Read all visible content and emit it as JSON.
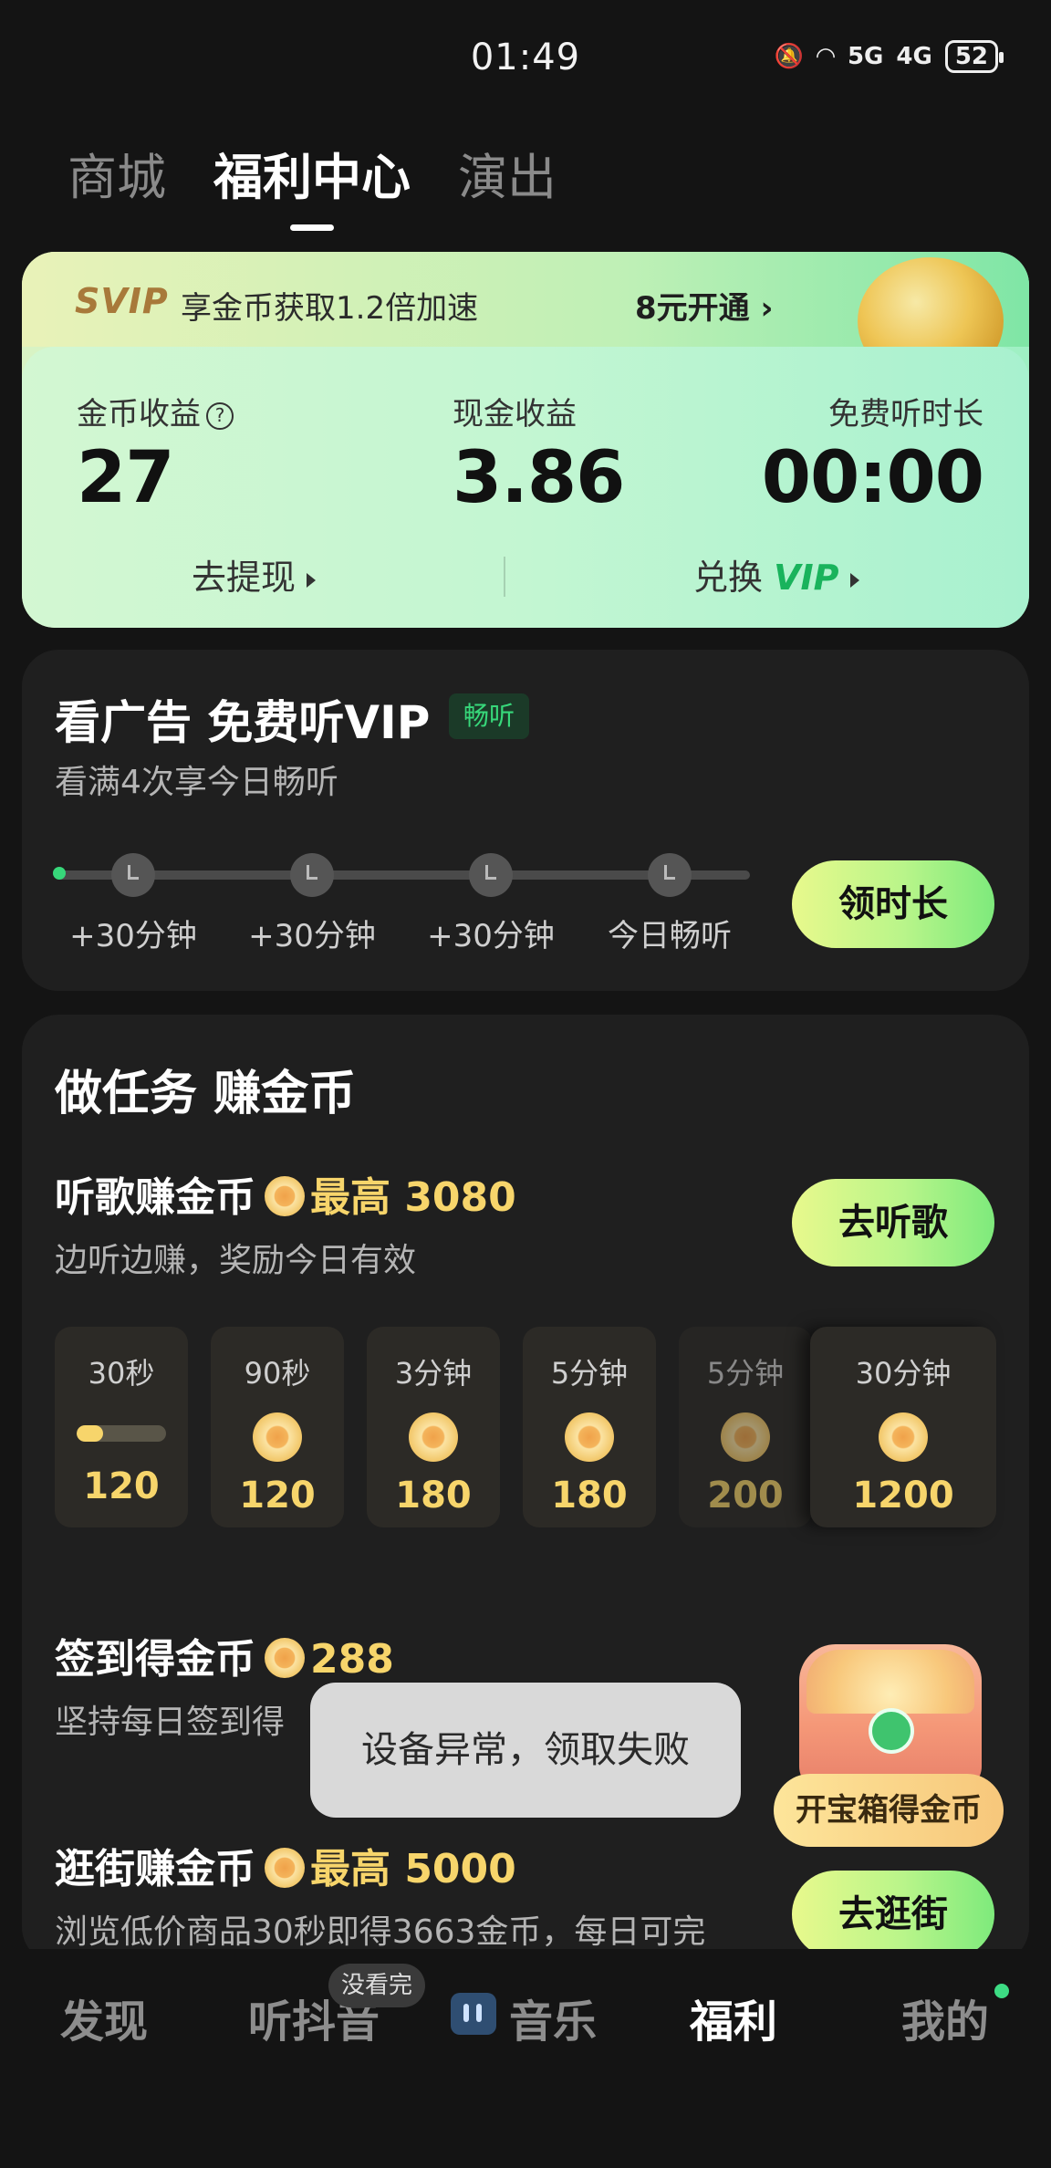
{
  "status_bar": {
    "time": "01:49",
    "battery": "52",
    "net1": "5G",
    "net2": "4G"
  },
  "top_tabs": [
    {
      "label": "商城"
    },
    {
      "label": "福利中心"
    },
    {
      "label": "演出"
    }
  ],
  "summary_card": {
    "svip_logo": "SVIP",
    "svip_text": "享金币获取1.2倍加速",
    "svip_open": "8元开通 ›",
    "stats": [
      {
        "label": "金币收益",
        "value": "27"
      },
      {
        "label": "现金收益",
        "value": "3.86"
      },
      {
        "label": "免费听时长",
        "value": "00:00"
      }
    ],
    "withdraw_label": "去提现",
    "exchange_label": "兑换",
    "exchange_vip": "VIP"
  },
  "ad_section": {
    "title": "看广告 免费听VIP",
    "badge": "畅听",
    "subtitle": "看满4次享今日畅听",
    "steps": [
      "+30分钟",
      "+30分钟",
      "+30分钟",
      "今日畅听"
    ],
    "button": "领时长"
  },
  "tasks": {
    "title": "做任务 赚金币",
    "listen": {
      "name": "听歌赚金币",
      "reward": "最高 3080",
      "subtitle": "边听边赚，奖励今日有效",
      "button": "去听歌",
      "tiles": [
        {
          "time": "30秒",
          "value": "120",
          "progress": 0.3
        },
        {
          "time": "90秒",
          "value": "120"
        },
        {
          "time": "3分钟",
          "value": "180"
        },
        {
          "time": "5分钟",
          "value": "180"
        },
        {
          "time": "5分钟",
          "value": "200"
        },
        {
          "time": "30分钟",
          "value": "1200"
        }
      ]
    },
    "signin": {
      "name": "签到得金币",
      "reward": "288",
      "subtitle": "坚持每日签到得"
    },
    "chest": {
      "label": "开宝箱得金币"
    },
    "shopping": {
      "name": "逛街赚金币",
      "reward": "最高 5000",
      "subtitle": "浏览低价商品30秒即得3663金币，每日可完",
      "button": "去逛街"
    }
  },
  "toast": "设备异常，领取失败",
  "bottom_nav": {
    "items": [
      "发现",
      "听抖音",
      "音乐",
      "福利",
      "我的"
    ],
    "badge": "没看完",
    "active": "福利"
  },
  "colors": {
    "accent_green": "#37d87a",
    "gold": "#f7d56b",
    "background": "#141414",
    "panel": "#1f1f1f"
  }
}
